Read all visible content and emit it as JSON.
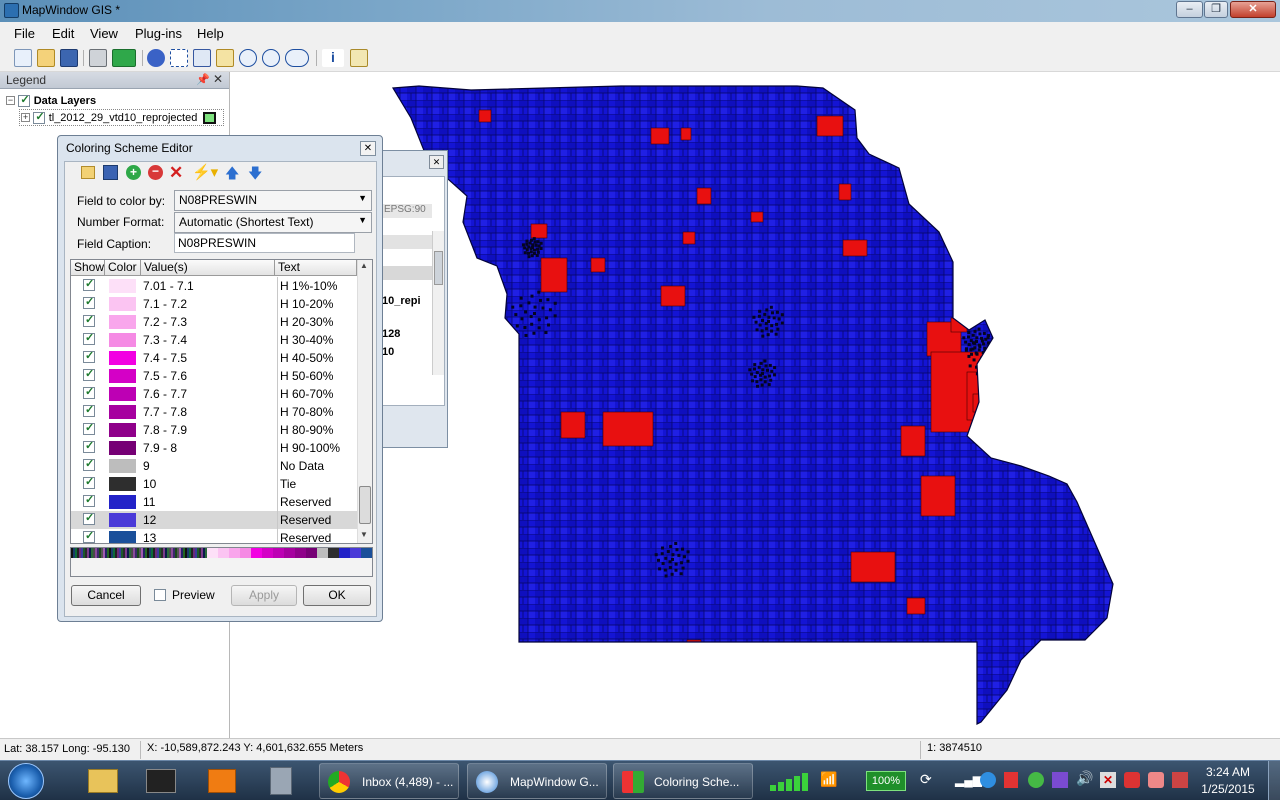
{
  "window": {
    "title": "MapWindow GIS *"
  },
  "menu": [
    "File",
    "Edit",
    "View",
    "Plug-ins",
    "Help"
  ],
  "legend": {
    "title": "Legend",
    "group_label": "Data Layers",
    "layer_name": "tl_2012_29_vtd10_reprojected"
  },
  "props_window": {
    "crs_fragment": "EPSG:90",
    "name_fragment": "10_repi",
    "value_1": "128",
    "value_2": "10"
  },
  "editor": {
    "title": "Coloring Scheme Editor",
    "field_to_color_by_label": "Field to color by:",
    "field_to_color_by_value": "N08PRESWIN",
    "number_format_label": "Number Format:",
    "number_format_value": "Automatic (Shortest Text)",
    "field_caption_label": "Field Caption:",
    "field_caption_value": "N08PRESWIN",
    "columns": [
      "Show",
      "Color",
      "Value(s)",
      "Text"
    ],
    "rows": [
      {
        "value": "7.01 - 7.1",
        "text": "H 1%-10%",
        "color": "#fde0f8",
        "selected": false
      },
      {
        "value": "7.1 - 7.2",
        "text": "H 10-20%",
        "color": "#fbc4f2",
        "selected": false
      },
      {
        "value": "7.2 - 7.3",
        "text": "H 20-30%",
        "color": "#f9a6ec",
        "selected": false
      },
      {
        "value": "7.3 - 7.4",
        "text": "H 30-40%",
        "color": "#f58ae4",
        "selected": false
      },
      {
        "value": "7.4 - 7.5",
        "text": "H 40-50%",
        "color": "#f200e2",
        "selected": false
      },
      {
        "value": "7.5 - 7.6",
        "text": "H 50-60%",
        "color": "#d400c6",
        "selected": false
      },
      {
        "value": "7.6 - 7.7",
        "text": "H 60-70%",
        "color": "#bd00b4",
        "selected": false
      },
      {
        "value": "7.7 - 7.8",
        "text": "H 70-80%",
        "color": "#a6009f",
        "selected": false
      },
      {
        "value": "7.8 - 7.9",
        "text": "H 80-90%",
        "color": "#8f008a",
        "selected": false
      },
      {
        "value": "7.9 - 8",
        "text": "H 90-100%",
        "color": "#760075",
        "selected": false
      },
      {
        "value": "9",
        "text": "No Data",
        "color": "#bdbdbd",
        "selected": false
      },
      {
        "value": "10",
        "text": "Tie",
        "color": "#2e2e2e",
        "selected": false
      },
      {
        "value": "11",
        "text": "Reserved",
        "color": "#2222c8",
        "selected": false
      },
      {
        "value": "12",
        "text": "Reserved",
        "color": "#4a3ad8",
        "selected": true
      },
      {
        "value": "13",
        "text": "Reserved",
        "color": "#1a4f9a",
        "selected": false
      }
    ],
    "preview_label": "Preview",
    "cancel_label": "Cancel",
    "apply_label": "Apply",
    "ok_label": "OK"
  },
  "status": {
    "latlong": "Lat: 38.157 Long: -95.130",
    "xy": "X: -10,589,872.243 Y: 4,601,632.655 Meters",
    "scale": "1: 3874510"
  },
  "taskbar": {
    "tasks": [
      "Inbox (4,489) - ...",
      "MapWindow G...",
      "Coloring Sche..."
    ],
    "battery": "100%",
    "time": "3:24 AM",
    "date": "1/25/2015"
  },
  "colors": {
    "map_blue": "#1010d8",
    "map_dark_blue": "#0a0aa0",
    "map_red": "#e81010"
  }
}
